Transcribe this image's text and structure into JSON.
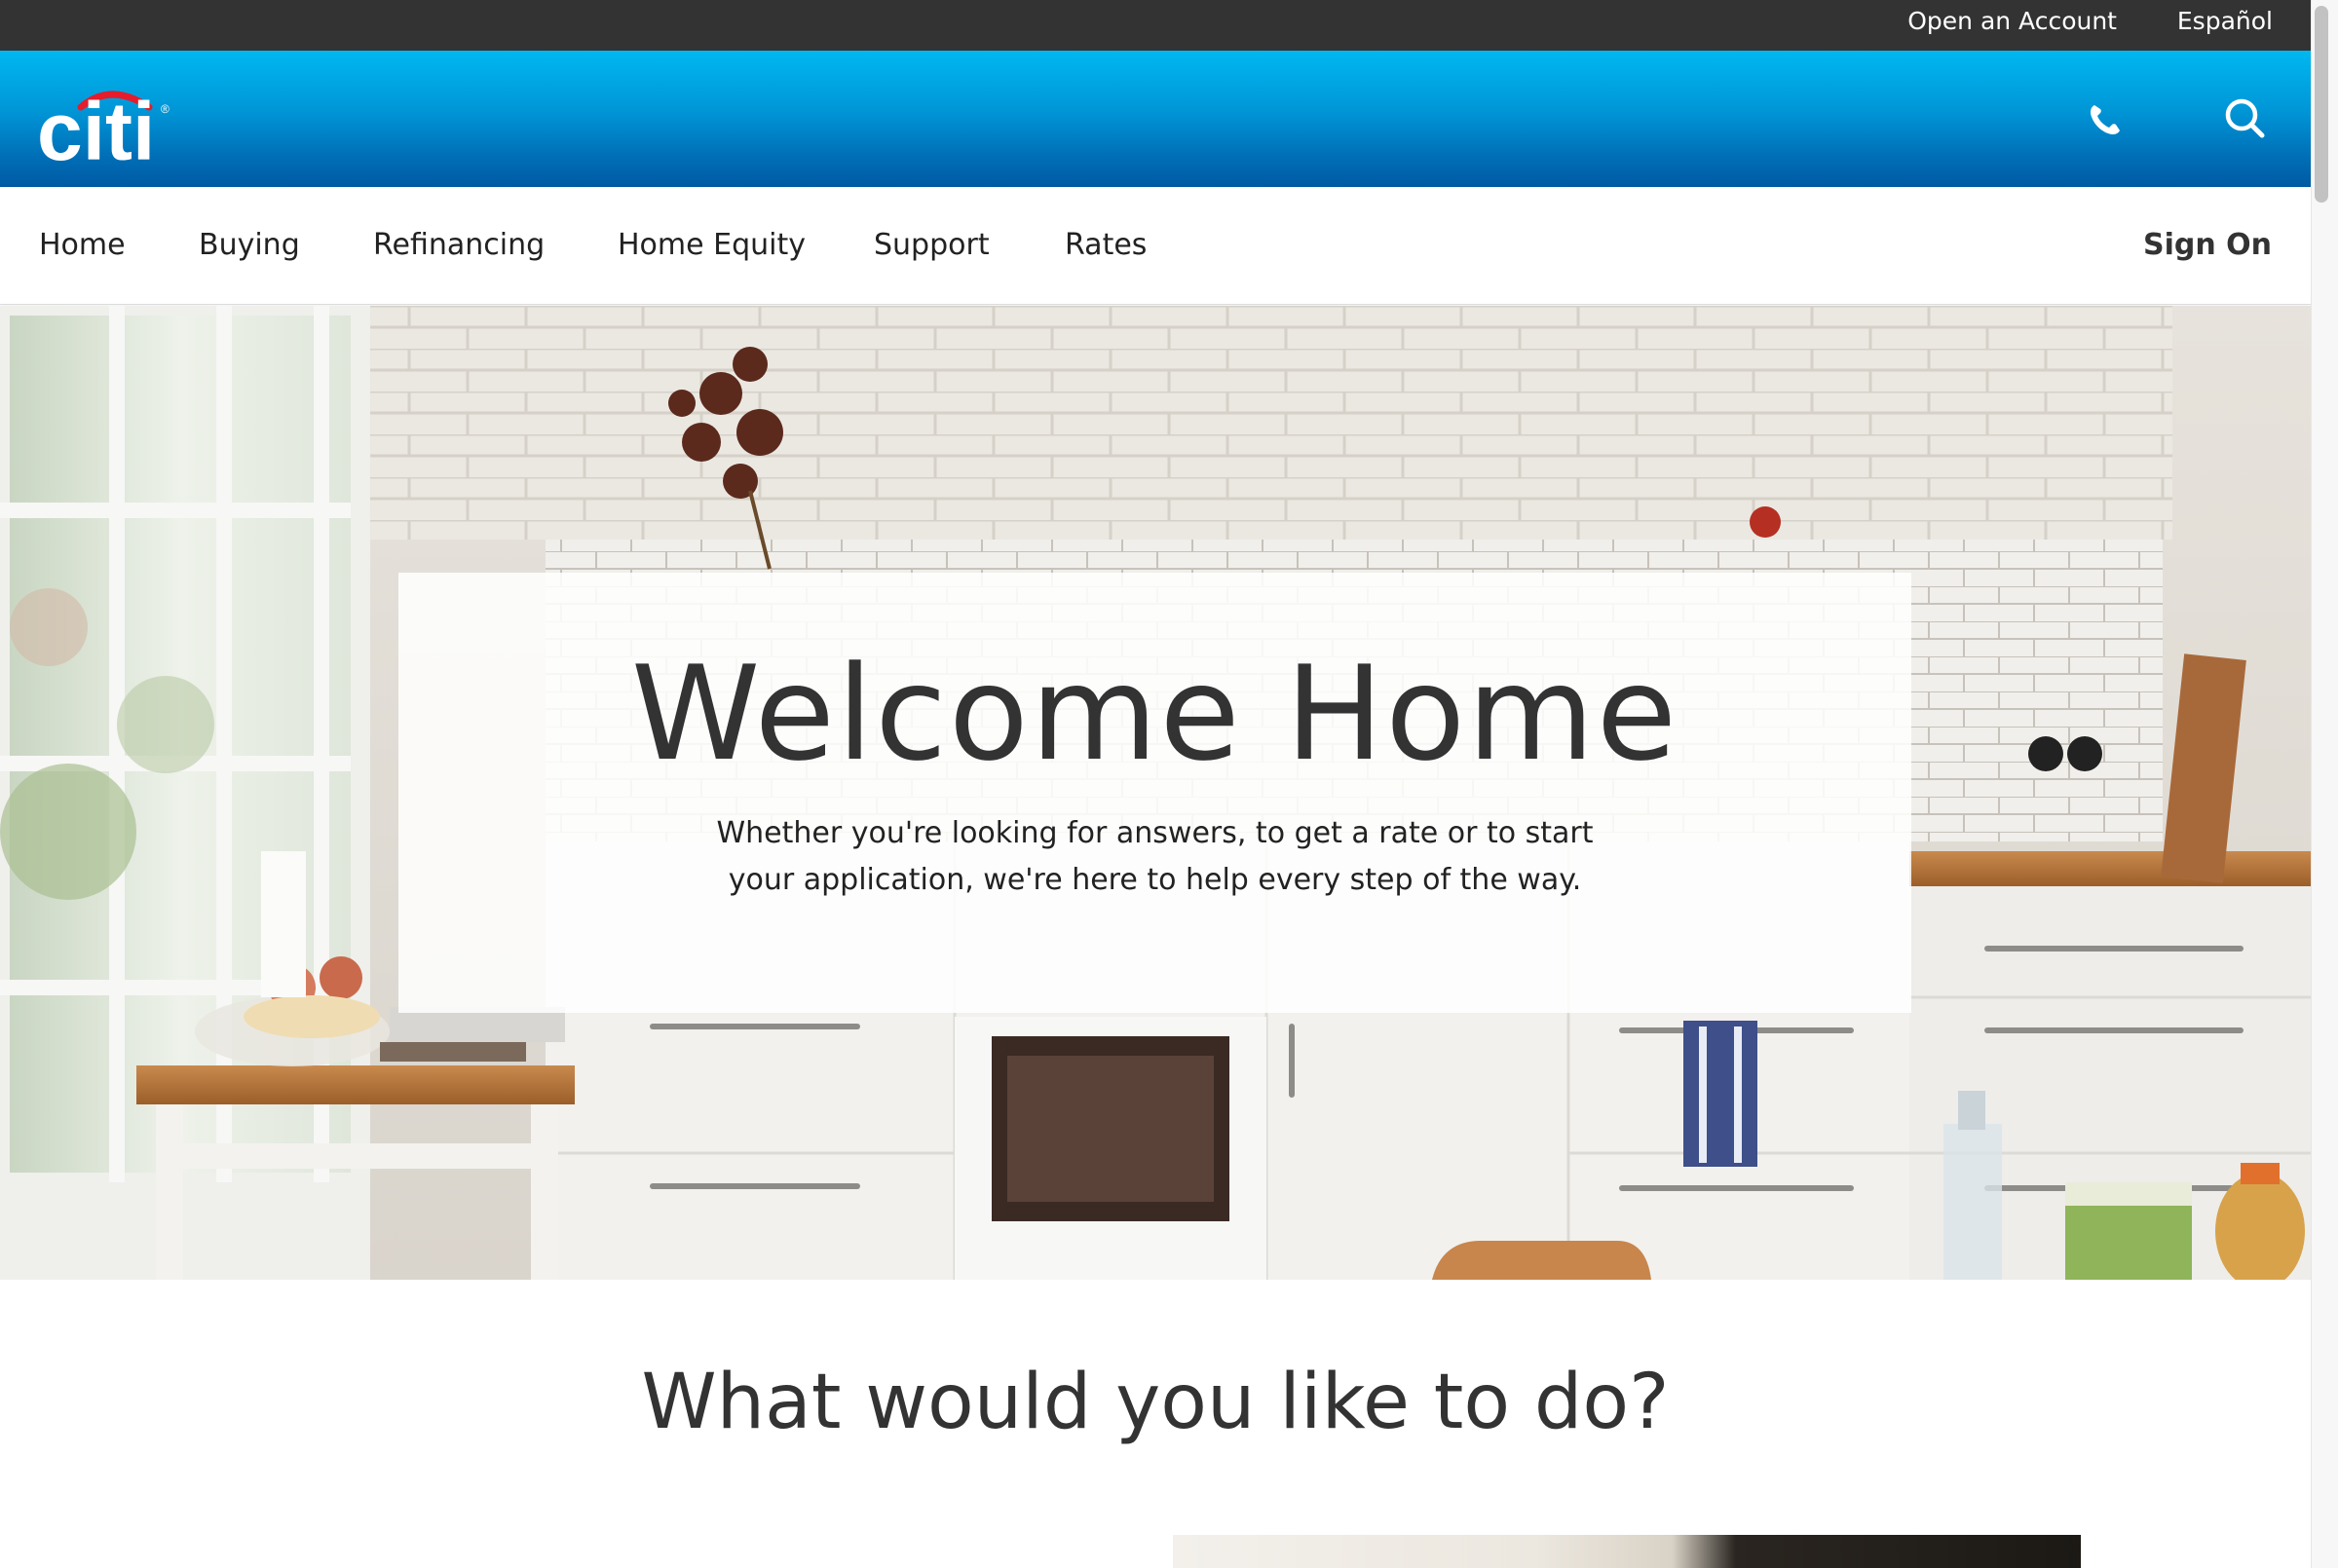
{
  "utility_bar": {
    "open_account": "Open an Account",
    "espanol": "Español"
  },
  "header": {
    "logo_text": "citi",
    "phone_icon": "phone-icon",
    "search_icon": "search-icon",
    "colors": {
      "utility_bar": "#333333",
      "brand_top": "#00b8f0",
      "brand_bottom": "#005aa3",
      "logo_arc": "#e41c2c"
    }
  },
  "nav": {
    "items": [
      {
        "label": "Home"
      },
      {
        "label": "Buying"
      },
      {
        "label": "Refinancing"
      },
      {
        "label": "Home Equity"
      },
      {
        "label": "Support"
      },
      {
        "label": "Rates"
      }
    ],
    "sign_on": "Sign On"
  },
  "hero": {
    "title": "Welcome Home",
    "subtitle": "Whether you're looking for answers, to get a rate or to start your application, we're here to help every step of the way."
  },
  "section": {
    "heading": "What would you like to do?"
  }
}
